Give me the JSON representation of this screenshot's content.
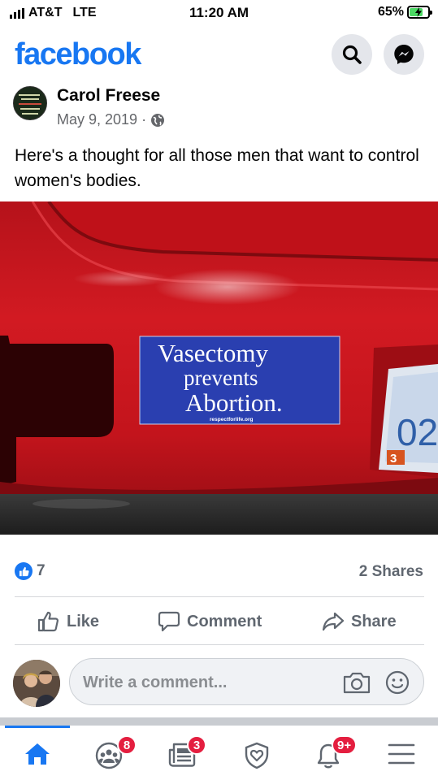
{
  "status_bar": {
    "carrier": "AT&T",
    "network": "LTE",
    "time": "11:20 AM",
    "battery": "65%",
    "battery_level": 0.65
  },
  "header": {
    "logo": "facebook",
    "search_icon": "search-icon",
    "messenger_icon": "messenger-icon"
  },
  "post": {
    "author": "Carol Freese",
    "date": "May 9, 2019",
    "date_separator": "·",
    "privacy_icon": "globe-icon",
    "text": "Here's a thought for all those men that want to control women's bodies.",
    "photo": {
      "sticker_line1": "Vasectomy",
      "sticker_line2": "prevents",
      "sticker_line3": "Abortion.",
      "sticker_url": "respectforlife.org",
      "plate_text": "02",
      "plate_sticker": "3"
    },
    "like_count": "7",
    "shares": "2 Shares",
    "actions": {
      "like": "Like",
      "comment": "Comment",
      "share": "Share"
    },
    "comment_placeholder": "Write a comment..."
  },
  "tabbar": {
    "items": [
      {
        "name": "home-icon",
        "badge": ""
      },
      {
        "name": "groups-icon",
        "badge": "8"
      },
      {
        "name": "news-icon",
        "badge": "3"
      },
      {
        "name": "shield-icon",
        "badge": ""
      },
      {
        "name": "bell-icon",
        "badge": "9+"
      },
      {
        "name": "menu-icon",
        "badge": ""
      }
    ]
  },
  "colors": {
    "brand": "#1877f2",
    "badge": "#e41e3f",
    "car_red": "#c8131a",
    "sticker_blue": "#2a3fb0"
  }
}
